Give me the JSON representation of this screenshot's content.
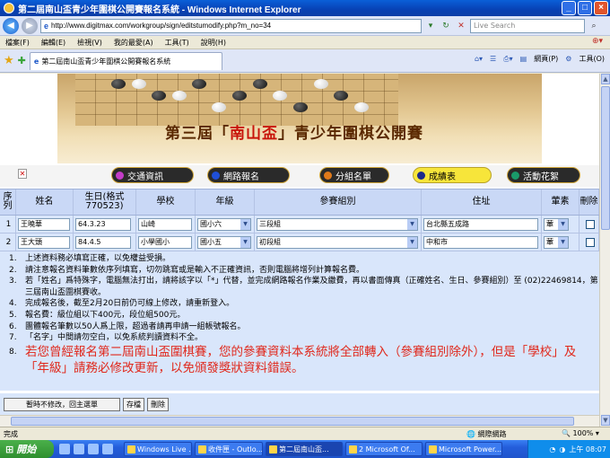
{
  "window": {
    "title": "第二屆南山盃青少年圍棋公開賽報名系統 - Windows Internet Explorer",
    "min_label": "_",
    "max_label": "□",
    "close_label": "×"
  },
  "addressbar": {
    "url": "http://www.digitmax.com/workgroup/sign/editstumodify.php?m_no=34",
    "search_placeholder": "Live Search"
  },
  "menu": [
    "檔案(F)",
    "編輯(E)",
    "檢視(V)",
    "我的最愛(A)",
    "工具(T)",
    "說明(H)"
  ],
  "tab": {
    "label": "第二屆南山盃青少年圍棋公開賽報名系統"
  },
  "toolbar": {
    "page_label": "網頁(P)",
    "tools_label": "工具(O)"
  },
  "banner": {
    "title_pre": "第三屆「",
    "title_red": "南山盃",
    "title_post": "」青少年圍棋公開賽"
  },
  "nav": [
    {
      "label": "交通資訊",
      "dot": "#c33cc8"
    },
    {
      "label": "網路報名",
      "dot": "#1f4fd8"
    },
    {
      "label": "分組名單",
      "dot": "#e07a1a"
    },
    {
      "label": "成績表",
      "dot": "#1c2a8a"
    },
    {
      "label": "活動花絮",
      "dot": "#1a9a6a"
    }
  ],
  "form": {
    "headers": [
      "序列",
      "姓名",
      "生日(格式770523)",
      "學校",
      "年級",
      "參賽組別",
      "住址",
      "葷素",
      "刪除"
    ],
    "rows": [
      {
        "no": "1",
        "name": "王曉華",
        "birthday": "64.3.23",
        "school": "山崎",
        "grade": "國小六",
        "group": "三段組",
        "address": "台北縣五成路",
        "diet": "葷"
      },
      {
        "no": "2",
        "name": "王大頭",
        "birthday": "84.4.5",
        "school": "小學國小",
        "grade": "國小五",
        "group": "初段組",
        "address": "中和市",
        "diet": "葷"
      }
    ]
  },
  "notes": [
    {
      "n": "1.",
      "text": "上述資料務必填寫正確，以免權益受損。"
    },
    {
      "n": "2.",
      "text": "請注意報名資料筆數依序列填寫，切勿跳寫或是輸入不正確資訊，否則電腦將增列計算報名費。"
    },
    {
      "n": "3.",
      "text": "若「姓名」爲特殊字，電腦無法打出，請將該字以「*」代替，並完成網路報名作業及繳費，再以書面傳真（正確姓名、生日、參賽組別）至 (02)22469814，第三屆南山盃圍棋賽收。"
    },
    {
      "n": "4.",
      "text": "完成報名後，截至2月20日前仍可線上修改，請重新登入。"
    },
    {
      "n": "5.",
      "text": "報名費：級位組以下400元，段位組500元。"
    },
    {
      "n": "6.",
      "text": "團體報名筆數以50人爲上限，超過者請再申請一組帳號報名。"
    },
    {
      "n": "7.",
      "text": "「名字」中間請勿空白，以免系統判讀資料不全。"
    },
    {
      "n": "8.",
      "text": "若您曾經報名第二屆南山盃圍棋賽，您的參賽資料本系統將全部轉入（參賽組別除外），但是「學校」及「年級」請務必修改更新，以免頒發獎狀資料錯誤。"
    }
  ],
  "buttons": {
    "back": "暫時不修改，回主選單",
    "save": "存檔",
    "delete": "刪除"
  },
  "status": {
    "left": "完成",
    "zone": "網際網路",
    "zoom": "100%"
  },
  "taskbar": {
    "start": "開始",
    "tasks": [
      "Windows Live ...",
      "收件匣 - Outlo...",
      "第二屆南山盃...",
      "2 Microsoft Of...",
      "Microsoft Power..."
    ],
    "clock": "上午 08:07"
  }
}
